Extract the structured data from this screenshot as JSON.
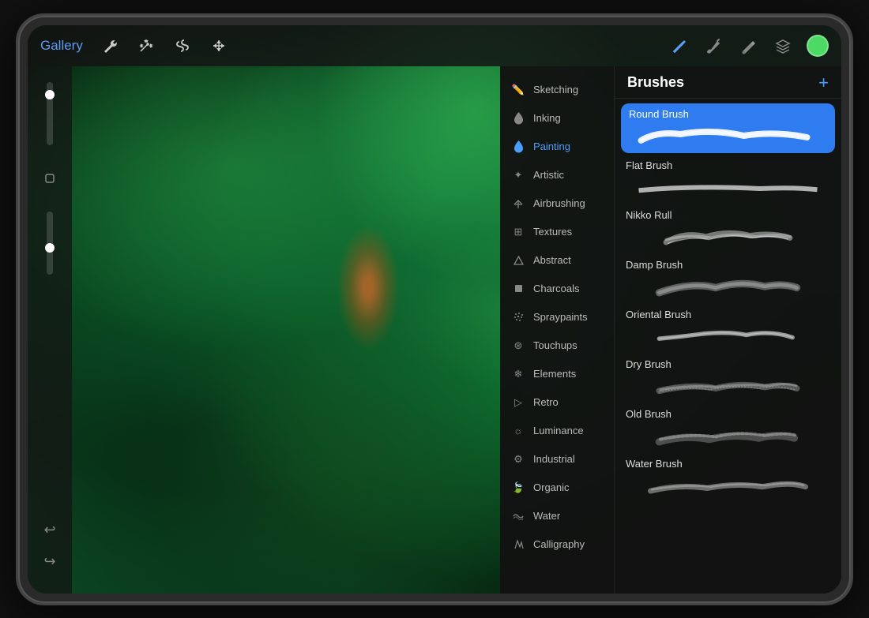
{
  "tablet": {
    "toolbar": {
      "gallery_label": "Gallery",
      "color_dot_color": "#4cd964",
      "tools_left": [
        "wrench",
        "magic",
        "s-shape",
        "arrow"
      ],
      "tools_right": [
        "pen-blue",
        "brush-dark",
        "pencil-dark",
        "layers"
      ]
    },
    "brushes_panel": {
      "title": "Brushes",
      "add_button": "+",
      "categories": [
        {
          "id": "sketching",
          "label": "Sketching",
          "icon": "pencil"
        },
        {
          "id": "inking",
          "label": "Inking",
          "icon": "drop"
        },
        {
          "id": "painting",
          "label": "Painting",
          "icon": "drop-fill",
          "active": true
        },
        {
          "id": "artistic",
          "label": "Artistic",
          "icon": "star"
        },
        {
          "id": "airbrushing",
          "label": "Airbrushing",
          "icon": "spray"
        },
        {
          "id": "textures",
          "label": "Textures",
          "icon": "grid"
        },
        {
          "id": "abstract",
          "label": "Abstract",
          "icon": "triangle"
        },
        {
          "id": "charcoals",
          "label": "Charcoals",
          "icon": "square-fill"
        },
        {
          "id": "spraypaints",
          "label": "Spraypaints",
          "icon": "circle-dots"
        },
        {
          "id": "touchups",
          "label": "Touchups",
          "icon": "wand"
        },
        {
          "id": "elements",
          "label": "Elements",
          "icon": "snowflake"
        },
        {
          "id": "retro",
          "label": "Retro",
          "icon": "arrow-right"
        },
        {
          "id": "luminance",
          "label": "Luminance",
          "icon": "sun"
        },
        {
          "id": "industrial",
          "label": "Industrial",
          "icon": "gear"
        },
        {
          "id": "organic",
          "label": "Organic",
          "icon": "leaf"
        },
        {
          "id": "water",
          "label": "Water",
          "icon": "waves"
        },
        {
          "id": "calligraphy",
          "label": "Calligraphy",
          "icon": "pen-nib"
        }
      ],
      "brushes": [
        {
          "id": "round-brush",
          "name": "Round Brush",
          "selected": true
        },
        {
          "id": "flat-brush",
          "name": "Flat Brush",
          "selected": false
        },
        {
          "id": "nikko-rull",
          "name": "Nikko Rull",
          "selected": false
        },
        {
          "id": "damp-brush",
          "name": "Damp Brush",
          "selected": false
        },
        {
          "id": "oriental-brush",
          "name": "Oriental Brush",
          "selected": false
        },
        {
          "id": "dry-brush",
          "name": "Dry Brush",
          "selected": false
        },
        {
          "id": "old-brush",
          "name": "Old Brush",
          "selected": false
        },
        {
          "id": "water-brush",
          "name": "Water Brush",
          "selected": false
        }
      ]
    },
    "left_sidebar": {
      "tools": [
        "circle-o",
        "square-o"
      ],
      "undo_label": "↩",
      "redo_label": "↪"
    }
  }
}
